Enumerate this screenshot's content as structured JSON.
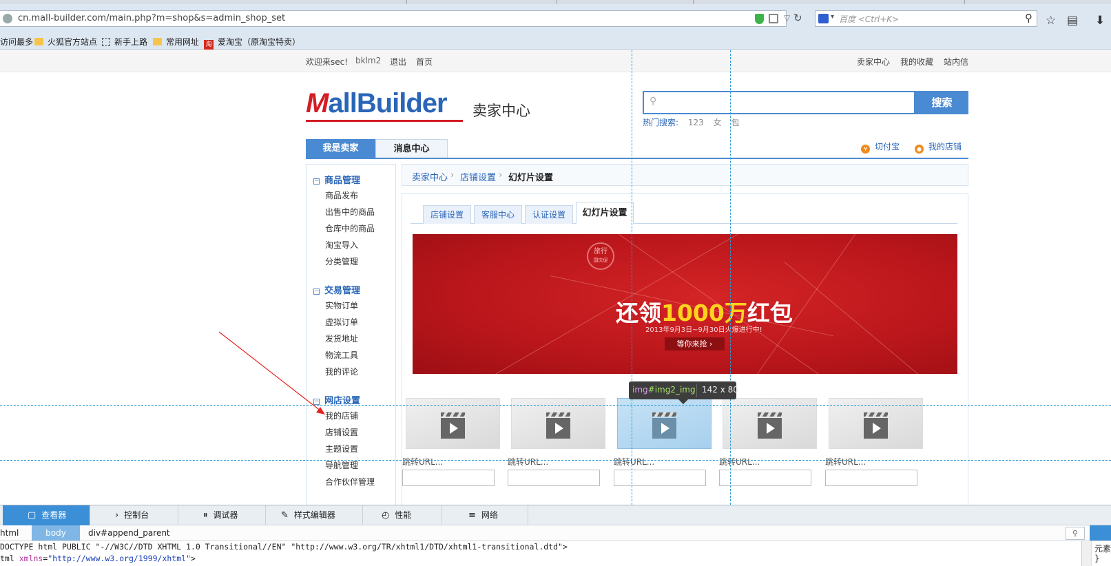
{
  "browser": {
    "url": "cn.mall-builder.com/main.php?m=shop&s=admin_shop_set",
    "search_placeholder": "百度 <Ctrl+K>"
  },
  "bookmarks": [
    {
      "label": "访问最多",
      "icon": "none"
    },
    {
      "label": "火狐官方站点",
      "icon": "folder-icon"
    },
    {
      "label": "新手上路",
      "icon": "dotted-page-icon"
    },
    {
      "label": "常用网址",
      "icon": "folder-icon"
    },
    {
      "label": "爱淘宝（原淘宝特卖）",
      "icon": "taobao-icon"
    }
  ],
  "topbar": {
    "welcome": "欢迎来sec!",
    "username": "bklm2",
    "logout": "退出",
    "home": "首页",
    "seller_center": "卖家中心",
    "favorites": "我的收藏",
    "inbox": "站内信"
  },
  "header": {
    "logo_prefix": "M",
    "logo_rest": "all",
    "logo_brand": "Builder",
    "logo_sub": "卖家中心",
    "search_button": "搜索",
    "hot_label": "热门搜索:",
    "hot_keywords": [
      "123",
      "女",
      "包"
    ]
  },
  "nav": {
    "tab_seller": "我是卖家",
    "tab_messages": "消息中心",
    "link_pay": "切付宝",
    "link_shop": "我的店铺"
  },
  "sidebar": {
    "groups": [
      {
        "title": "商品管理",
        "items": [
          "商品发布",
          "出售中的商品",
          "仓库中的商品",
          "淘宝导入",
          "分类管理"
        ]
      },
      {
        "title": "交易管理",
        "items": [
          "实物订单",
          "虚拟订单",
          "发货地址",
          "物流工具",
          "我的评论"
        ]
      },
      {
        "title": "网店设置",
        "items": [
          "我的店铺",
          "店铺设置",
          "主题设置",
          "导航管理",
          "合作伙伴管理"
        ]
      }
    ]
  },
  "breadcrumb": {
    "level1": "卖家中心",
    "level2": "店铺设置",
    "current": "幻灯片设置"
  },
  "subtabs": [
    "店铺设置",
    "客服中心",
    "认证设置",
    "幻灯片设置"
  ],
  "banner": {
    "stamp_line1": "旅行",
    "stamp_line2": "国庆促",
    "headline_pre": "还领",
    "headline_amount": "1000万",
    "headline_post": "红包",
    "date_text": "2013年9月3日~9月30日火爆进行中!",
    "button": "等你来抢 ›"
  },
  "slides": [
    {
      "url_label": "跳转URL...",
      "value": "",
      "selected": false
    },
    {
      "url_label": "跳转URL...",
      "value": "",
      "selected": false
    },
    {
      "url_label": "跳转URL...",
      "value": "",
      "selected": true
    },
    {
      "url_label": "跳转URL...",
      "value": "",
      "selected": false
    },
    {
      "url_label": "跳转URL...",
      "value": "",
      "selected": false
    }
  ],
  "inspector_tooltip": {
    "tag": "img",
    "id": "#img2_img",
    "dimensions": "142 x 80"
  },
  "devtools": {
    "tabs": [
      "查看器",
      "控制台",
      "调试器",
      "样式编辑器",
      "性能",
      "网络"
    ],
    "active_tab": "查看器",
    "breadcrumb": [
      "html",
      "body",
      "div#append_parent"
    ],
    "source_line1": "DOCTYPE html PUBLIC \"-//W3C//DTD XHTML 1.0 Transitional//EN\" \"http://www.w3.org/TR/xhtml1/DTD/xhtml1-transitional.dtd\">",
    "source_line2_tag": "tml",
    "source_line2_attr": "xmlns",
    "source_line2_val": "\"http://www.w3.org/1999/xhtml\"",
    "source_line2_end": ">",
    "side_label": "元素",
    "side_brace": "}"
  },
  "colors": {
    "accent_blue": "#4a8ad2",
    "logo_red": "#d31c24",
    "banner_red": "#c8161d",
    "headline_yellow": "#ffd21e"
  }
}
